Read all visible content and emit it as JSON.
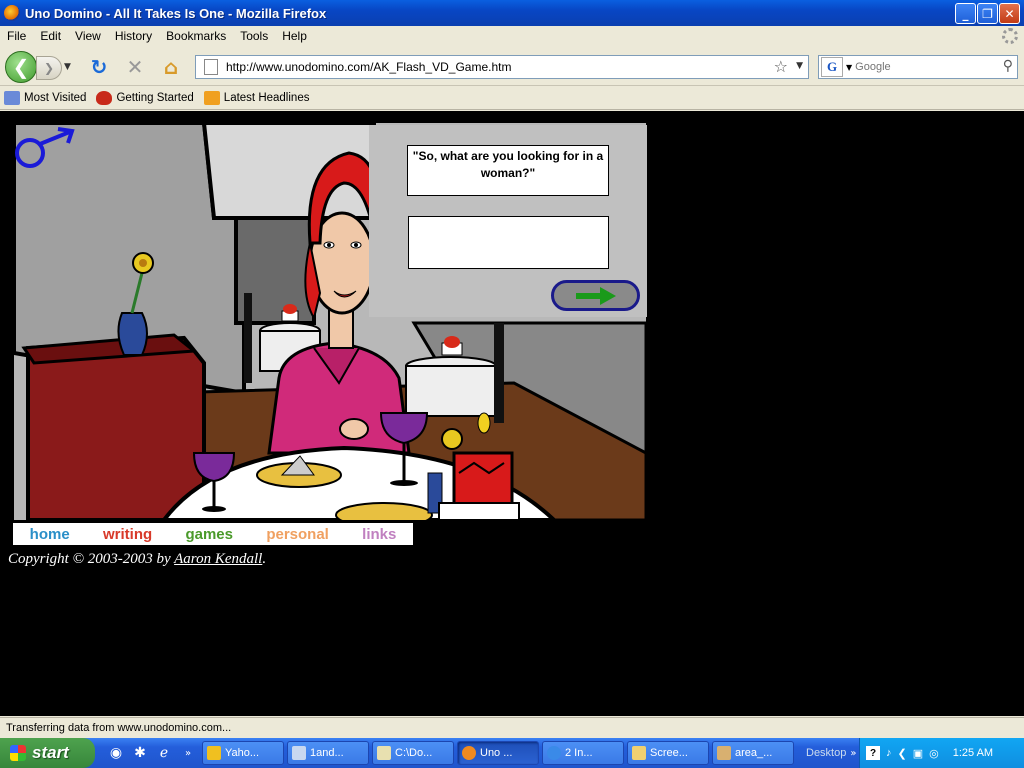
{
  "window": {
    "title": "Uno Domino - All It Takes Is One - Mozilla Firefox"
  },
  "menu": [
    "File",
    "Edit",
    "View",
    "History",
    "Bookmarks",
    "Tools",
    "Help"
  ],
  "nav": {
    "url": "http://www.unodomino.com/AK_Flash_VD_Game.htm",
    "search_placeholder": "Google"
  },
  "bookmarks": [
    "Most Visited",
    "Getting Started",
    "Latest Headlines"
  ],
  "game": {
    "question": "\"So, what are you looking for in a woman?\"",
    "answer": ""
  },
  "site_nav": [
    {
      "label": "home",
      "color": "#2a8fc8"
    },
    {
      "label": "writing",
      "color": "#d83a2a"
    },
    {
      "label": "games",
      "color": "#4a9a2a"
    },
    {
      "label": "personal",
      "color": "#f0a060"
    },
    {
      "label": "links",
      "color": "#c080c0"
    }
  ],
  "copyright": {
    "prefix": "Copyright © 2003-2003 by ",
    "author": "Aaron Kendall",
    "suffix": "."
  },
  "status": "Transferring data from www.unodomino.com...",
  "taskbar": {
    "start": "start",
    "tasks": [
      "Yaho...",
      "1and...",
      "C:\\Do...",
      "Uno ...",
      "2 In...",
      "Scree...",
      "area_..."
    ],
    "active_task": 3,
    "desktop": "Desktop",
    "clock": "1:25 AM"
  }
}
